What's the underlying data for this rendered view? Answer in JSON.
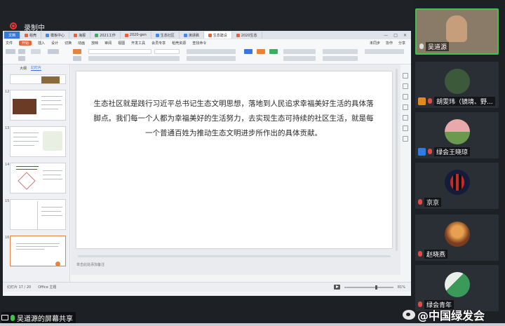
{
  "recording": {
    "label": "录制中"
  },
  "app": {
    "tabs": [
      "文档",
      "稻壳",
      "模板中心",
      "海报",
      "2021工作",
      "2020-gen",
      "生态社区",
      "演讲稿",
      "生态建设",
      "2020生态"
    ],
    "menu": [
      "文件",
      "开始",
      "插入",
      "设计",
      "切换",
      "动画",
      "放映",
      "审阅",
      "视图",
      "开发工具",
      "会员专享",
      "稻壳资源",
      "查找命令"
    ],
    "menu_right": [
      "未同步",
      "协作",
      "分享"
    ],
    "panel_tabs": [
      "大纲",
      "幻灯片"
    ],
    "slide_numbers": [
      "12",
      "13",
      "14",
      "15",
      "16",
      "17"
    ],
    "notes_placeholder": "单击此处添加备注",
    "status_left": "幻灯片 17 / 20",
    "status_mid": "Office 主题",
    "zoom": "81%"
  },
  "slide": {
    "text": "生态社区就是践行习近平总书记生态文明思想，落地到人民追求幸福美好生活的具体落脚点。我们每一个人都为幸福美好的生活努力，去实现生态可持续的社区生活，就是每一个普通百姓为推动生态文明进步所作出的具体贡献。"
  },
  "participants": [
    {
      "name": "吴道源",
      "active": true
    },
    {
      "name": "胡雯玮（镜境、野...",
      "active": false
    },
    {
      "name": "绿会王晓琼",
      "active": false
    },
    {
      "name": "京京",
      "active": false
    },
    {
      "name": "赵晓燕",
      "active": false
    },
    {
      "name": "绿会青年",
      "active": false
    }
  ],
  "share_label": "吴道源的屏幕共享",
  "watermark": "@中国绿发会"
}
